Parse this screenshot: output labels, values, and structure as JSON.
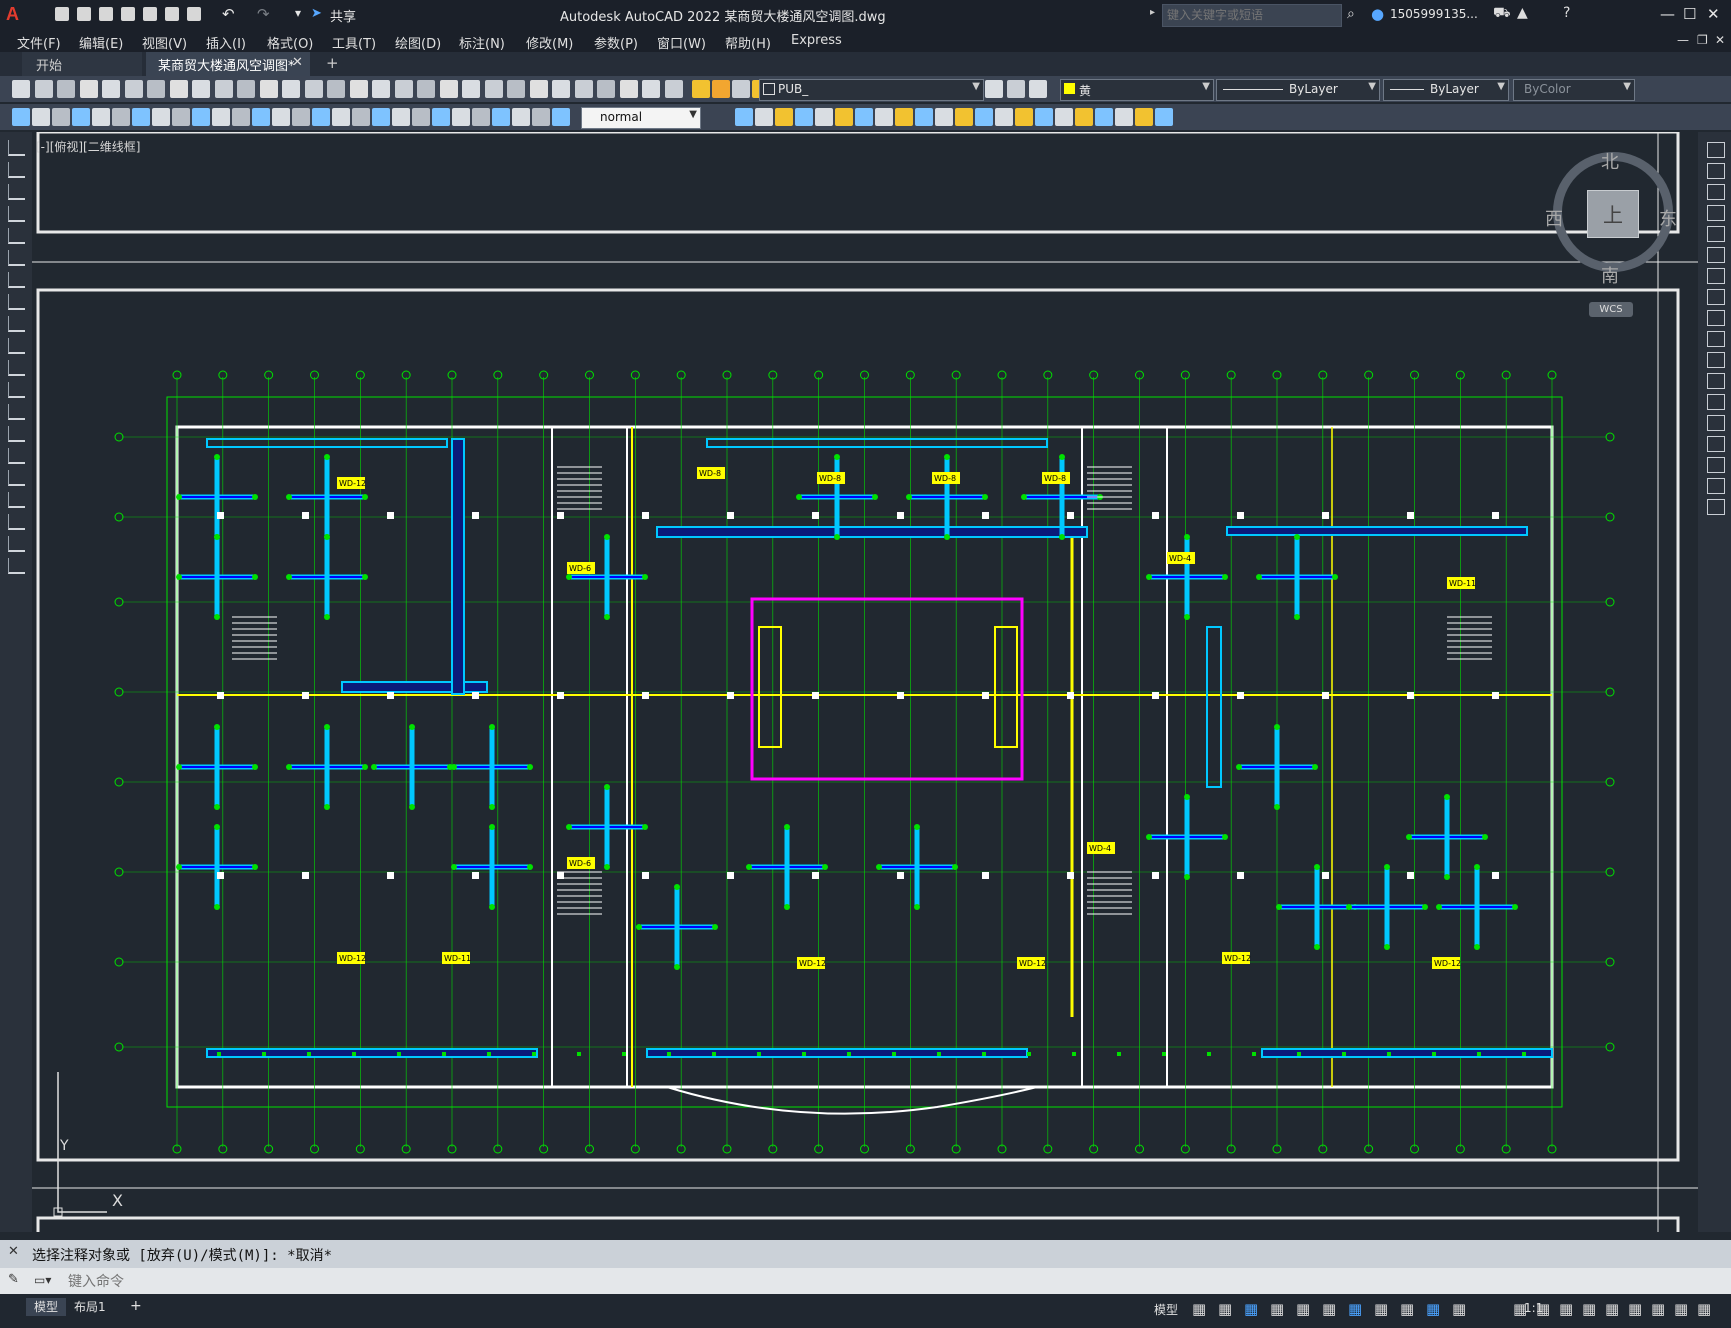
{
  "app": {
    "title": "Autodesk AutoCAD 2022   某商贸大楼通风空调图.dwg",
    "logo": "A",
    "share_label": "共享",
    "search_placeholder": "键入关键字或短语",
    "user_label": "1505999135...",
    "window_buttons": {
      "minimize": "—",
      "restore": "☐",
      "close": "✕"
    }
  },
  "menu": [
    "文件(F)",
    "编辑(E)",
    "视图(V)",
    "插入(I)",
    "格式(O)",
    "工具(T)",
    "绘图(D)",
    "标注(N)",
    "修改(M)",
    "参数(P)",
    "窗口(W)",
    "帮助(H)",
    "Express"
  ],
  "tabs": {
    "start": "开始",
    "document": "某商贸大楼通风空调图*",
    "add": "+"
  },
  "toolbar": {
    "layer_value": "PUB_",
    "color_value": "黄",
    "linetype_value": "ByLayer",
    "lineweight_value": "ByLayer",
    "plotstyle_value": "ByColor",
    "textstyle_value": "normal"
  },
  "viewport": {
    "label": "[-][俯视][二维线框]",
    "compass": {
      "north": "北",
      "south": "南",
      "east": "东",
      "west": "西",
      "top": "上"
    },
    "wcs": "WCS",
    "ucs_x": "X",
    "ucs_y": "Y"
  },
  "drawing": {
    "unit_labels": [
      "WD-12",
      "WD-6",
      "WD-8",
      "WD-11",
      "WD-4"
    ],
    "colors": {
      "background": "#212830",
      "grid": "#00e000",
      "duct": "#00c8ff",
      "wall": "#ffffff",
      "accent": "#ffff00",
      "frame": "#ff00ff",
      "pipe": "#0000ff"
    }
  },
  "command": {
    "history": "选择注释对象或 [放弃(U)/模式(M)]: *取消*",
    "input_placeholder": "键入命令"
  },
  "status": {
    "tab_model": "模型",
    "tab_layout1": "布局1",
    "add": "+",
    "model_label": "模型",
    "scale": "1:1"
  }
}
